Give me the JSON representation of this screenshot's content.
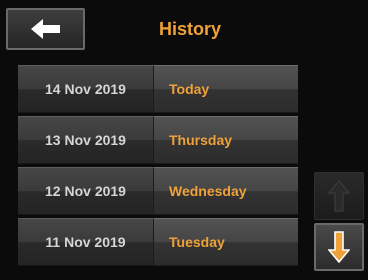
{
  "header": {
    "title": "History",
    "back_icon": "arrow-left-icon"
  },
  "history": {
    "rows": [
      {
        "date": "14 Nov 2019",
        "day": "Today"
      },
      {
        "date": "13 Nov 2019",
        "day": "Thursday"
      },
      {
        "date": "12 Nov 2019",
        "day": "Wednesday"
      },
      {
        "date": "11 Nov 2019",
        "day": "Tuesday"
      }
    ]
  },
  "scroll": {
    "up_icon": "arrow-up-icon",
    "down_icon": "arrow-down-icon",
    "up_enabled": false,
    "down_enabled": true
  },
  "colors": {
    "accent": "#f0a23a",
    "date_text": "#d6d6d6",
    "background": "#0b0b0b"
  }
}
